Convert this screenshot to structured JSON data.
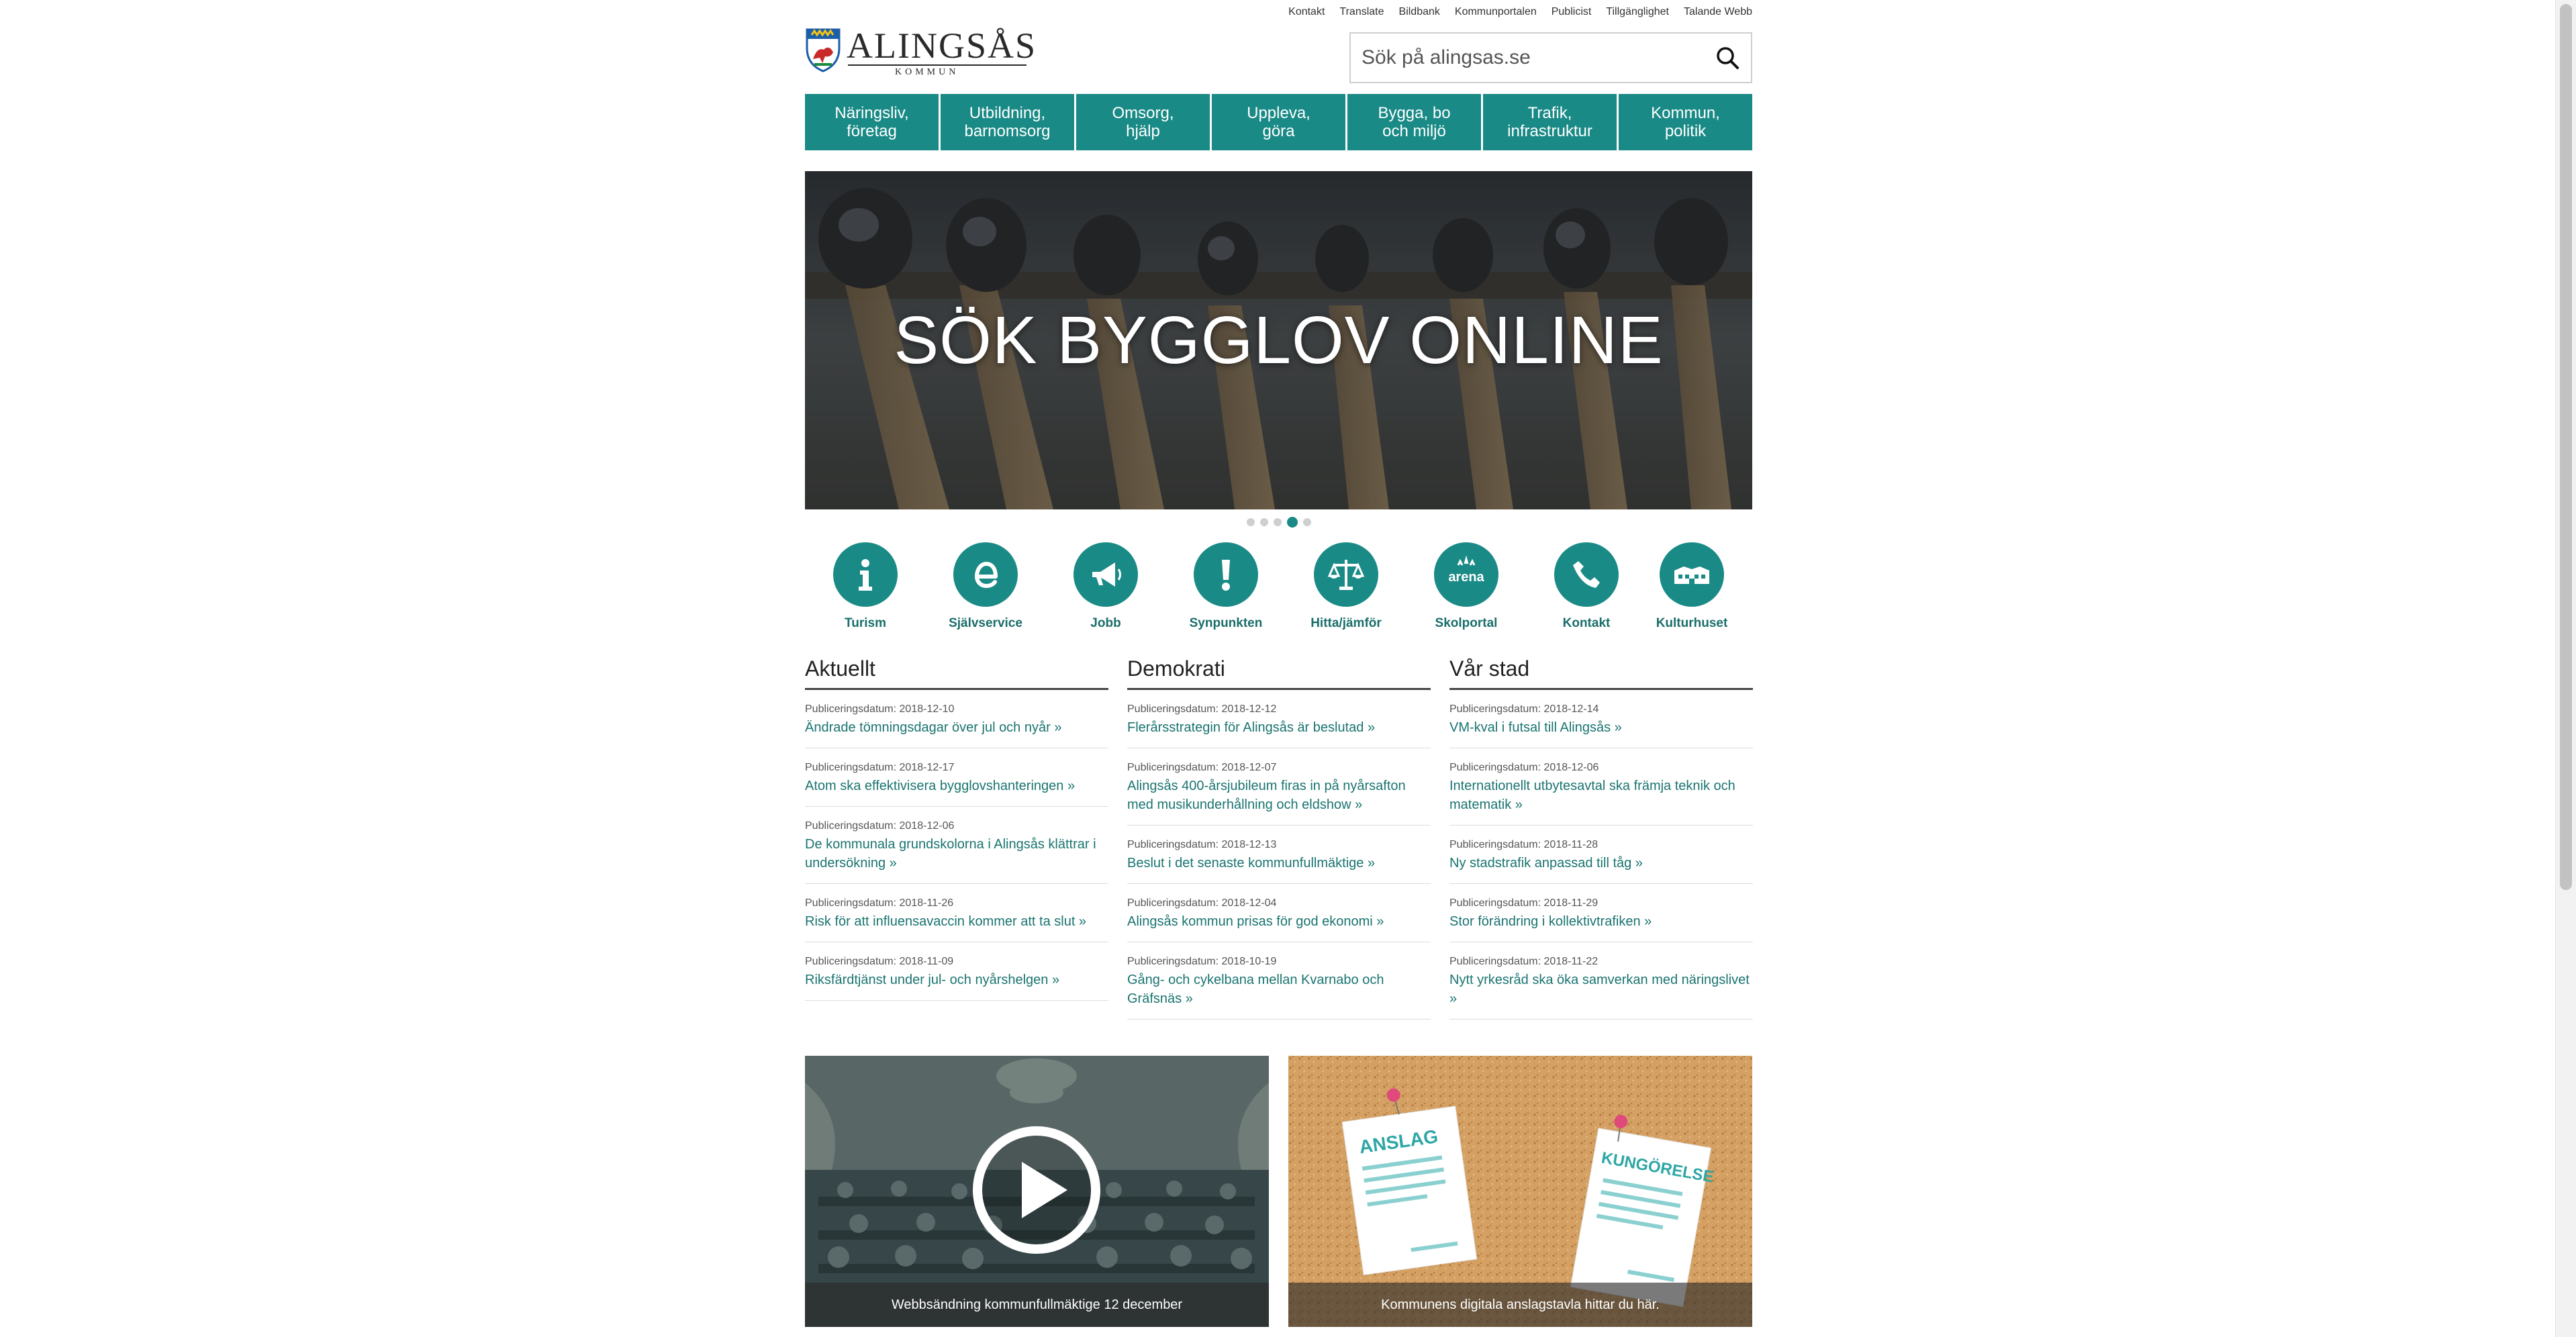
{
  "util_nav": [
    "Kontakt",
    "Translate",
    "Bildbank",
    "Kommunportalen",
    "Publicist",
    "Tillgänglighet",
    "Talande Webb"
  ],
  "logo": {
    "wordmark": "ALINGSÅS",
    "sub": "KOMMUN"
  },
  "search": {
    "placeholder": "Sök på alingsas.se"
  },
  "main_nav": [
    {
      "line1": "Näringsliv,",
      "line2": "företag"
    },
    {
      "line1": "Utbildning,",
      "line2": "barnomsorg"
    },
    {
      "line1": "Omsorg,",
      "line2": "hjälp"
    },
    {
      "line1": "Uppleva,",
      "line2": "göra"
    },
    {
      "line1": "Bygga, bo",
      "line2": "och miljö"
    },
    {
      "line1": "Trafik,",
      "line2": "infrastruktur"
    },
    {
      "line1": "Kommun,",
      "line2": "politik"
    }
  ],
  "hero": {
    "title": "SÖK BYGGLOV ONLINE",
    "slide_count": 5,
    "active_slide": 4
  },
  "quick_links": [
    {
      "label": "Turism",
      "icon": "info-icon"
    },
    {
      "label": "Självservice",
      "icon": "e-service-icon"
    },
    {
      "label": "Jobb",
      "icon": "megaphone-icon"
    },
    {
      "label": "Synpunkten",
      "icon": "exclamation-icon"
    },
    {
      "label": "Hitta/jämför",
      "icon": "scales-icon"
    },
    {
      "label": "Skolportal",
      "icon": "arena-icon",
      "icon_text": "arena"
    },
    {
      "label": "Kontakt",
      "icon": "phone-icon"
    },
    {
      "label": "Kulturhuset",
      "icon": "building-icon"
    }
  ],
  "columns": [
    {
      "title": "Aktuellt",
      "items": [
        {
          "date": "Publiceringsdatum: 2018-12-10",
          "title": "Ändrade tömningsdagar över jul och nyår »"
        },
        {
          "date": "Publiceringsdatum: 2018-12-17",
          "title": "Atom ska effektivisera bygglovshanteringen »"
        },
        {
          "date": "Publiceringsdatum: 2018-12-06",
          "title": "De kommunala grundskolorna i Alingsås klättrar i undersökning »"
        },
        {
          "date": "Publiceringsdatum: 2018-11-26",
          "title": "Risk för att influensavaccin kommer att ta slut »"
        },
        {
          "date": "Publiceringsdatum: 2018-11-09",
          "title": "Riksfärdtjänst under jul- och nyårshelgen »"
        }
      ]
    },
    {
      "title": "Demokrati",
      "items": [
        {
          "date": "Publiceringsdatum: 2018-12-12",
          "title": "Flerårsstrategin för Alingsås är beslutad »"
        },
        {
          "date": "Publiceringsdatum: 2018-12-07",
          "title": "Alingsås 400-årsjubileum firas in på nyårsafton med musikunderhållning och eldshow »"
        },
        {
          "date": "Publiceringsdatum: 2018-12-13",
          "title": "Beslut i det senaste kommunfullmäktige »"
        },
        {
          "date": "Publiceringsdatum: 2018-12-04",
          "title": "Alingsås kommun prisas för god ekonomi »"
        },
        {
          "date": "Publiceringsdatum: 2018-10-19",
          "title": "Gång- och cykelbana mellan Kvarnabo och Gräfsnäs »"
        }
      ]
    },
    {
      "title": "Vår stad",
      "items": [
        {
          "date": "Publiceringsdatum: 2018-12-14",
          "title": "VM-kval i futsal till Alingsås »"
        },
        {
          "date": "Publiceringsdatum: 2018-12-06",
          "title": "Internationellt utbytesavtal ska främja teknik och matematik »"
        },
        {
          "date": "Publiceringsdatum: 2018-11-28",
          "title": "Ny stadstrafik anpassad till tåg »"
        },
        {
          "date": "Publiceringsdatum: 2018-11-29",
          "title": "Stor förändring i kollektivtrafiken »"
        },
        {
          "date": "Publiceringsdatum: 2018-11-22",
          "title": "Nytt yrkesråd ska öka samverkan med näringslivet »"
        }
      ]
    }
  ],
  "cards": [
    {
      "caption": "Webbsändning kommunfullmäktige 12 december",
      "icon": "play-icon"
    },
    {
      "caption": "Kommunens digitala anslagstavla hittar du här.",
      "notes": [
        "ANSLAG",
        "KUNGÖRELSE"
      ]
    }
  ],
  "colors": {
    "accent": "#1a8a86",
    "link": "#1a7470"
  }
}
